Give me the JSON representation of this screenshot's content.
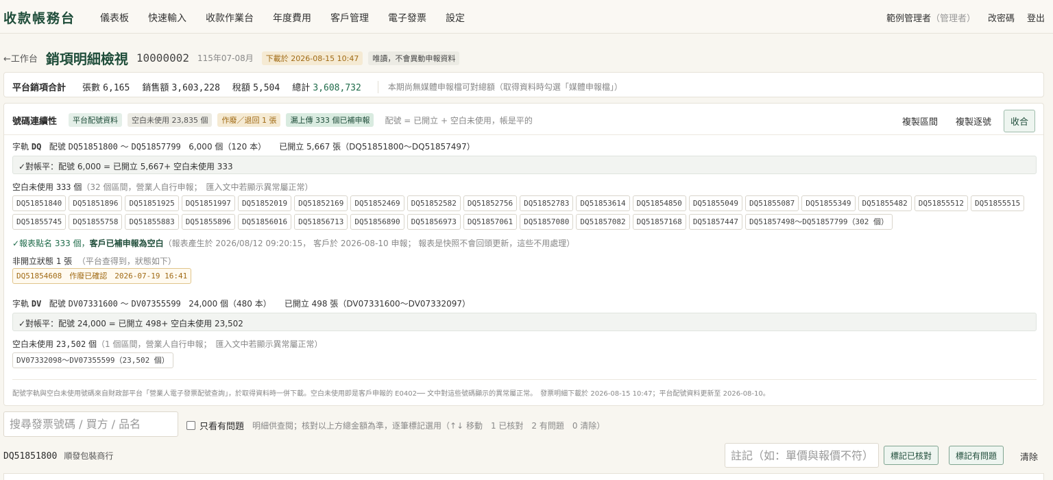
{
  "nav": {
    "brand": "收款帳務台",
    "items": [
      "儀表板",
      "快速輸入",
      "收款作業台",
      "年度費用",
      "客戶管理",
      "電子發票",
      "設定"
    ],
    "user": "範例管理者",
    "role": "（管理者）",
    "change_password": "改密碼",
    "logout": "登出"
  },
  "header": {
    "back": "←工作台",
    "title": "銷項明細檢視",
    "number": "10000002",
    "period": "115年07-08月",
    "downloaded_tag": "下載於 2026-08-15 10:47",
    "readonly_tag": "唯讀，不會異動申報資料"
  },
  "summary": {
    "label": "平台銷項合計",
    "count_label": "張數",
    "count": "6,165",
    "sales_label": "銷售額",
    "sales": "3,603,228",
    "tax_label": "稅額",
    "tax": "5,504",
    "total_label": "總計",
    "total": "3,608,732",
    "note": "本期尚無媒體申報檔可對總額（取得資料時勾選「媒體申報檔」）"
  },
  "sequence": {
    "title": "號碼連續性",
    "tags": {
      "platform": "平台配號資料",
      "blank": "空白未使用 23,835 個",
      "void": "作廢／退回 1 張",
      "missed": "漏上傳 333 個已補申報"
    },
    "legend": "配號 = 已開立 + 空白未使用，帳是平的",
    "copy_ranges": "複製區間",
    "copy_each": "複製逐號",
    "collapse": "收合",
    "dq": {
      "track_prefix": "字軌",
      "track": "DQ",
      "assigned_label": "配號",
      "assigned_from": "DQ51851800",
      "tilde": "～",
      "assigned_to": "DQ51857799",
      "qty": "6,000 個（120 本）",
      "issued": "已開立 5,667 張（DQ51851800～DQ51857497）",
      "balance": "✓對帳平：配號 6,000 = 已開立 5,667+ 空白未使用 333",
      "blank_label": "空白未使用",
      "blank_count": "333",
      "blank_unit": "個",
      "blank_note": "（32 個區間，營業人自行申報；　匯入文中若顯示異常屬正常）",
      "chips": [
        "DQ51851840",
        "DQ51851896",
        "DQ51851925",
        "DQ51851997",
        "DQ51852019",
        "DQ51852169",
        "DQ51852469",
        "DQ51852582",
        "DQ51852756",
        "DQ51852783",
        "DQ51853614",
        "DQ51854850",
        "DQ51855049",
        "DQ51855087",
        "DQ51855349",
        "DQ51855482",
        "DQ51855512",
        "DQ51855515",
        "DQ51855745",
        "DQ51855758",
        "DQ51855883",
        "DQ51855896",
        "DQ51856016",
        "DQ51856713",
        "DQ51856890",
        "DQ51856973",
        "DQ51857061",
        "DQ51857080",
        "DQ51857082",
        "DQ51857168",
        "DQ51857447",
        "DQ51857498～DQ51857799（302 個）"
      ],
      "reported_prefix": "✓報表點名 333 個，",
      "reported_strong": "客戶已補申報為空白",
      "reported_note": "（報表產生於 2026/08/12 09:20:15， 客戶於 2026-08-10 申報； 報表是快照不會回頭更新，這些不用處理）",
      "nonopen_label": "非開立狀態 1 張",
      "nonopen_note": "（平台查得到，狀態如下）",
      "void_chip": "DQ51854608　作廢已確認　2026-07-19 16:41"
    },
    "dv": {
      "track_prefix": "字軌",
      "track": "DV",
      "assigned_label": "配號",
      "assigned_from": "DV07331600",
      "tilde": "～",
      "assigned_to": "DV07355599",
      "qty": "24,000 個（480 本）",
      "issued": "已開立 498 張（DV07331600～DV07332097）",
      "balance": "✓對帳平：配號 24,000 = 已開立 498+ 空白未使用 23,502",
      "blank_label": "空白未使用",
      "blank_count": "23,502",
      "blank_unit": "個",
      "blank_note": "（1 個區間，營業人自行申報；　匯入文中若顯示異常屬正常）",
      "chips": [
        "DV07332098～DV07355599（23,502 個）"
      ]
    },
    "footnote": "配號字軌與空白未使用號碼來自財政部平台「營業人電子發票配號查詢」，於取得資料時一併下載。空白未使用即是客戶申報的 E0402── 文中對這些號碼顯示的異常屬正常。　發票明細下載於 2026-08-15 10:47；平台配號資料更新至 2026-08-10。"
  },
  "filter": {
    "search_placeholder": "搜尋發票號碼 / 買方 / 品名",
    "only_problems": "只看有問題",
    "hint": "明細供查閱；核對以上方總金額為準，逐筆標記選用（↑↓ 移動　1 已核對　2 有問題　0 清除）"
  },
  "detail": {
    "invoice": "DQ51851800",
    "buyer": "順發包裝商行",
    "note_placeholder": "註記（如：單價與報價不符）",
    "mark_ok": "標記已核對",
    "mark_problem": "標記有問題",
    "clear": "清除"
  }
}
